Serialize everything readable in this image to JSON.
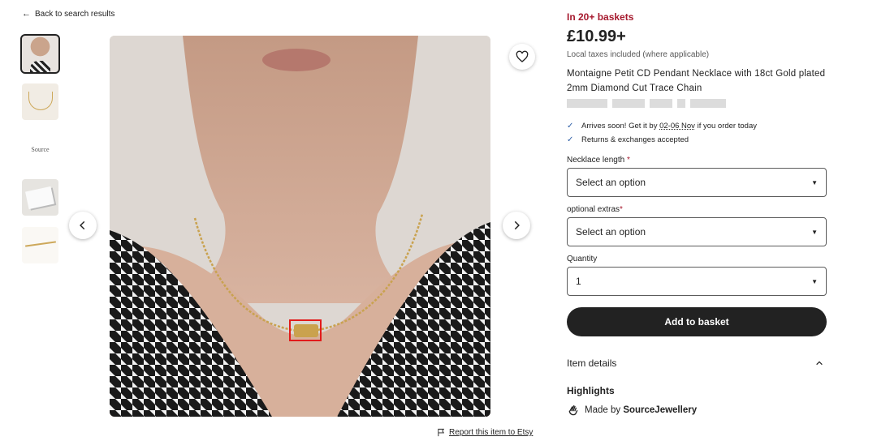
{
  "nav": {
    "back_label": "Back to search results"
  },
  "gallery": {
    "thumb_text_3": "Source",
    "report_label": "Report this item to Etsy"
  },
  "product": {
    "baskets_badge": "In 20+ baskets",
    "price": "£10.99+",
    "tax_note": "Local taxes included (where applicable)",
    "title": "Montaigne Petit CD Pendant Necklace with 18ct Gold plated 2mm Diamond Cut Trace Chain",
    "perks": [
      {
        "before": "Arrives soon! Get it by ",
        "date": "02-06 Nov",
        "after": " if you order today"
      },
      {
        "text": "Returns & exchanges accepted"
      }
    ]
  },
  "options": {
    "length_label": "Necklace length",
    "length_placeholder": "Select an option",
    "extras_label": "optional extras",
    "extras_placeholder": "Select an option",
    "quantity_label": "Quantity",
    "quantity_value": "1",
    "required_mark": "*"
  },
  "actions": {
    "add_to_basket": "Add to basket"
  },
  "details": {
    "item_details_label": "Item details",
    "highlights_label": "Highlights",
    "made_by_prefix": "Made by ",
    "shop_name": "SourceJewellery"
  },
  "colors": {
    "accent_red": "#a61a2e",
    "button_dark": "#222222",
    "check_blue": "#2f5fa7"
  }
}
